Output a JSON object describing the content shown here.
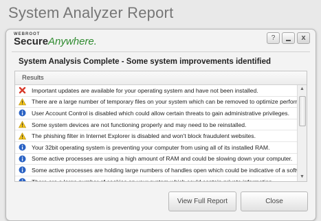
{
  "page": {
    "title": "System Analyzer Report"
  },
  "brand": {
    "small": "WEBROOT",
    "secure": "Secure",
    "anywhere": "Anywhere."
  },
  "window_buttons": {
    "help": "?",
    "close": "x"
  },
  "heading": "System Analysis Complete - Some system improvements identified",
  "results": {
    "header": "Results",
    "items": [
      {
        "icon": "error-x-icon",
        "text": "Important updates are available for your operating system and have not been installed."
      },
      {
        "icon": "warning-icon",
        "text": "There are a large number of temporary files on your system which can be removed to optimize performance."
      },
      {
        "icon": "info-icon",
        "text": "User Account Control is disabled which could allow certain threats to gain administrative privileges."
      },
      {
        "icon": "warning-icon",
        "text": "Some system devices are not functioning properly and may need to be reinstalled."
      },
      {
        "icon": "warning-icon",
        "text": "The phishing filter in Internet Explorer is disabled and won't block fraudulent websites."
      },
      {
        "icon": "info-icon",
        "text": "Your 32bit operating system is preventing your computer from using all of its installed RAM."
      },
      {
        "icon": "info-icon",
        "text": "Some active processes are using a high amount of RAM and could be slowing down your computer."
      },
      {
        "icon": "info-icon",
        "text": "Some active processes are holding large numbers of handles open which could be indicative of a software bug."
      },
      {
        "icon": "info-icon",
        "text": "There are a large number of cookies on your system which could contain private information."
      }
    ]
  },
  "buttons": {
    "view_full_report": "View Full Report",
    "close": "Close"
  },
  "colors": {
    "error": "#d83a2a",
    "warning": "#f1c21b",
    "info": "#2a62c4",
    "brand_green": "#2e8a2e"
  }
}
